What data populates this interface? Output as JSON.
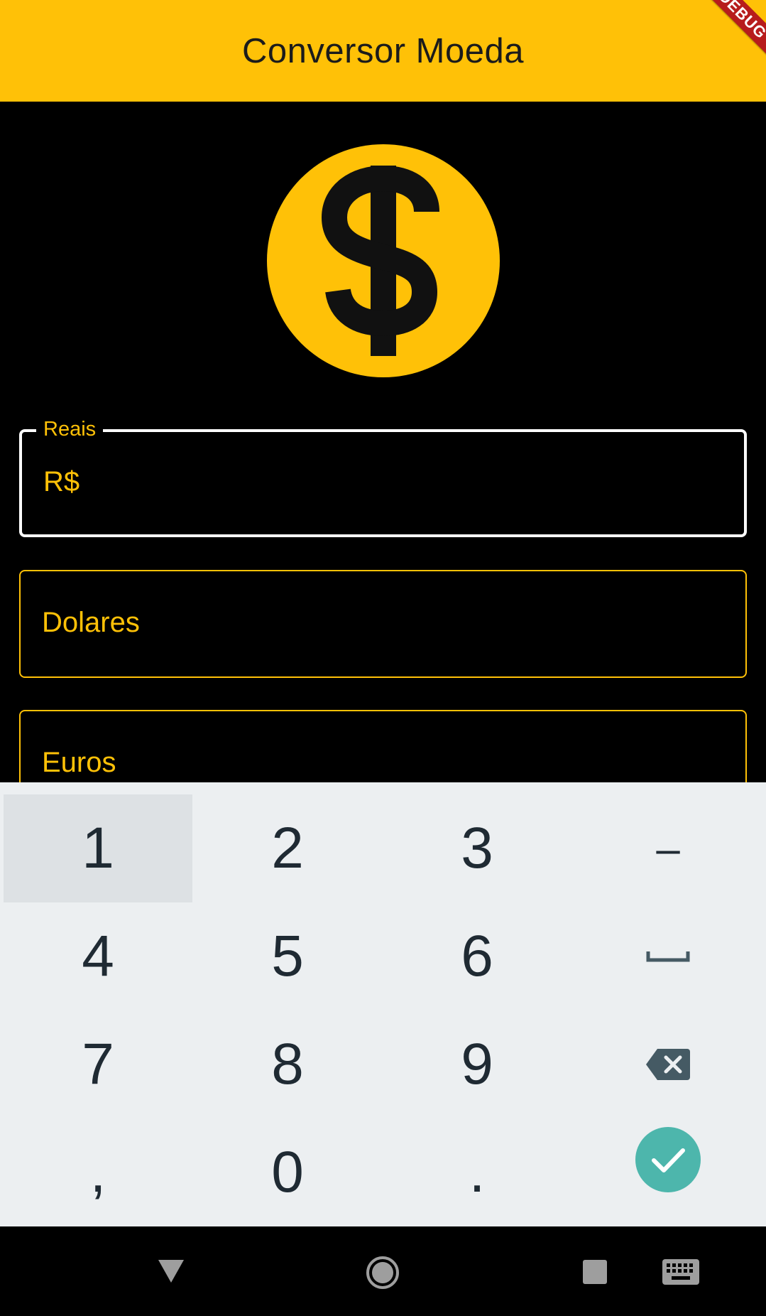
{
  "appbar": {
    "title": "Conversor Moeda",
    "debug_banner": "DEBUG"
  },
  "colors": {
    "accent": "#FFC107",
    "background": "#000000",
    "keyboard": "#ECEFF1",
    "done": "#4DB6AC"
  },
  "icons": {
    "hero": "dollar-coin-icon"
  },
  "fields": [
    {
      "label": "Reais",
      "prefix": "R$",
      "value": "",
      "focused": true
    },
    {
      "label": "Dolares",
      "value": "",
      "focused": false
    },
    {
      "label": "Euros",
      "value": "",
      "focused": false
    }
  ],
  "keyboard": {
    "rows": [
      [
        "1",
        "2",
        "3",
        "-"
      ],
      [
        "4",
        "5",
        "6",
        "space"
      ],
      [
        "7",
        "8",
        "9",
        "backspace"
      ],
      [
        ",",
        "0",
        ".",
        "done"
      ]
    ],
    "k1": "1",
    "k2": "2",
    "k3": "3",
    "kminus": "–",
    "k4": "4",
    "k5": "5",
    "k6": "6",
    "k7": "7",
    "k8": "8",
    "k9": "9",
    "kcomma": ",",
    "k0": "0",
    "kdot": "."
  },
  "navbar": [
    "back-icon",
    "home-icon",
    "recents-icon",
    "keyboard-switch-icon"
  ]
}
